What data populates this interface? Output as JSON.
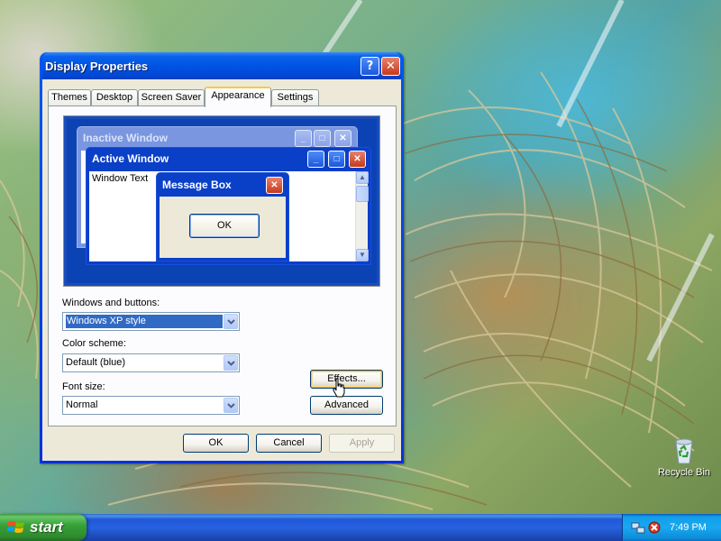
{
  "window": {
    "title": "Display Properties",
    "help_glyph": "?",
    "close_glyph": "✕"
  },
  "tabs": [
    {
      "label": "Themes"
    },
    {
      "label": "Desktop"
    },
    {
      "label": "Screen Saver"
    },
    {
      "label": "Appearance",
      "active": true
    },
    {
      "label": "Settings"
    }
  ],
  "preview": {
    "inactive_title": "Inactive Window",
    "active_title": "Active Window",
    "window_text": "Window Text",
    "message_box_title": "Message Box",
    "message_box_ok": "OK"
  },
  "form": {
    "windows_buttons_label": "Windows and buttons:",
    "windows_buttons_value": "Windows XP style",
    "color_scheme_label": "Color scheme:",
    "color_scheme_value": "Default (blue)",
    "font_size_label": "Font size:",
    "font_size_value": "Normal",
    "effects_button": "Effects...",
    "advanced_button": "Advanced"
  },
  "footer": {
    "ok": "OK",
    "cancel": "Cancel",
    "apply": "Apply"
  },
  "desktop": {
    "recycle_bin_label": "Recycle Bin"
  },
  "taskbar": {
    "start_label": "start",
    "clock": "7:49 PM"
  },
  "colors": {
    "title_blue": "#0054e3",
    "start_green": "#37a337",
    "selection": "#316ac5",
    "dialog_bg": "#ece9d8"
  }
}
